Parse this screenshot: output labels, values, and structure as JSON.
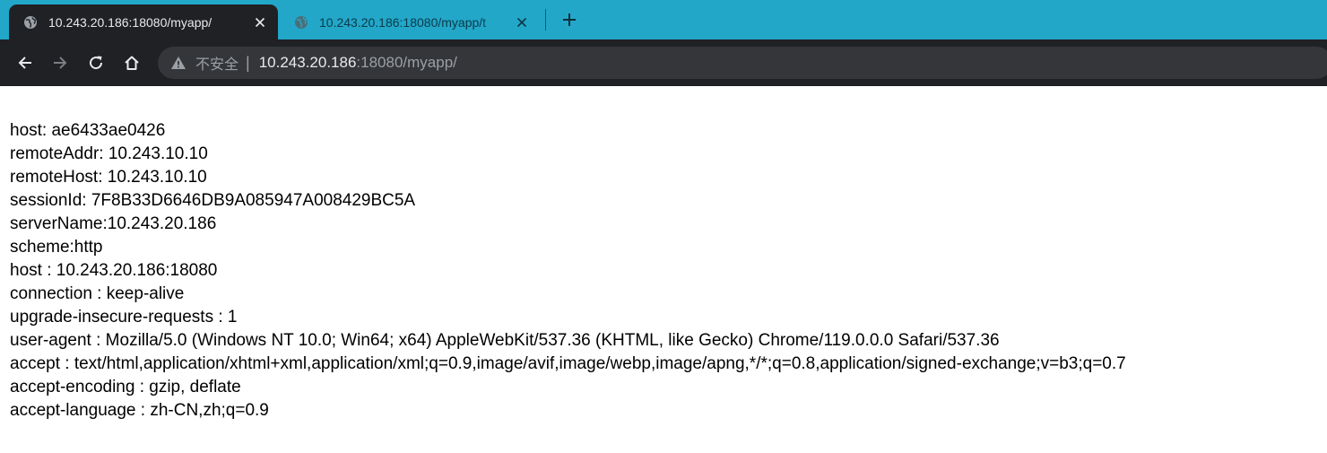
{
  "tabs": [
    {
      "title": "10.243.20.186:18080/myapp/",
      "active": true
    },
    {
      "title": "10.243.20.186:18080/myapp/t",
      "active": false
    }
  ],
  "icons": {
    "favicon": "globe-icon",
    "close": "close-icon",
    "new_tab": "plus-icon",
    "back": "arrow-left-icon",
    "forward": "arrow-right-icon",
    "reload": "reload-icon",
    "home": "home-icon",
    "security": "warning-triangle-icon"
  },
  "omnibox": {
    "security_label": "不安全",
    "separator": "|",
    "host": "10.243.20.186",
    "rest": ":18080/myapp/"
  },
  "colors": {
    "tabstrip": "#22a7c9",
    "toolbar": "#202124",
    "omnibox": "#35363a"
  },
  "content_lines": [
    "host: ae6433ae0426",
    "remoteAddr: 10.243.10.10",
    "remoteHost: 10.243.10.10",
    "sessionId: 7F8B33D6646DB9A085947A008429BC5A",
    "serverName:10.243.20.186",
    "scheme:http",
    "host : 10.243.20.186:18080",
    "connection : keep-alive",
    "upgrade-insecure-requests : 1",
    "user-agent : Mozilla/5.0 (Windows NT 10.0; Win64; x64) AppleWebKit/537.36 (KHTML, like Gecko) Chrome/119.0.0.0 Safari/537.36",
    "accept : text/html,application/xhtml+xml,application/xml;q=0.9,image/avif,image/webp,image/apng,*/*;q=0.8,application/signed-exchange;v=b3;q=0.7",
    "accept-encoding : gzip, deflate",
    "accept-language : zh-CN,zh;q=0.9"
  ]
}
